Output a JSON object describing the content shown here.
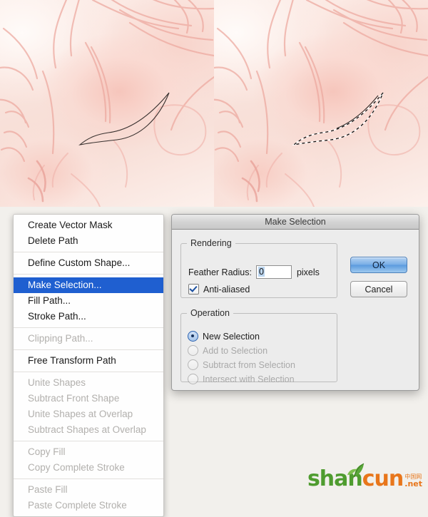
{
  "artwork": {
    "description": "anime-style face painting, left panel shows a vector path around the eye, right panel shows the resulting marching-ants selection",
    "panels": [
      {
        "name": "path-panel",
        "annotation": "bezier path outline"
      },
      {
        "name": "selection-panel",
        "annotation": "marching ants selection"
      }
    ],
    "colors": {
      "skin_light": "#fdf3ef",
      "skin_mid": "#f7dcd4",
      "line": "#e9a39b",
      "path_stroke": "#3a3230"
    }
  },
  "context_menu": {
    "name": "path-context-menu",
    "groups": [
      {
        "items": [
          {
            "label": "Create Vector Mask",
            "state": "enabled"
          },
          {
            "label": "Delete Path",
            "state": "enabled"
          }
        ]
      },
      {
        "items": [
          {
            "label": "Define Custom Shape...",
            "state": "enabled"
          }
        ]
      },
      {
        "items": [
          {
            "label": "Make Selection...",
            "state": "selected"
          },
          {
            "label": "Fill Path...",
            "state": "enabled"
          },
          {
            "label": "Stroke Path...",
            "state": "enabled"
          }
        ]
      },
      {
        "items": [
          {
            "label": "Clipping Path...",
            "state": "disabled"
          }
        ]
      },
      {
        "items": [
          {
            "label": "Free Transform Path",
            "state": "enabled"
          }
        ]
      },
      {
        "items": [
          {
            "label": "Unite Shapes",
            "state": "disabled"
          },
          {
            "label": "Subtract Front Shape",
            "state": "disabled"
          },
          {
            "label": "Unite Shapes at Overlap",
            "state": "disabled"
          },
          {
            "label": "Subtract Shapes at Overlap",
            "state": "disabled"
          }
        ]
      },
      {
        "items": [
          {
            "label": "Copy Fill",
            "state": "disabled"
          },
          {
            "label": "Copy Complete Stroke",
            "state": "disabled"
          }
        ]
      },
      {
        "items": [
          {
            "label": "Paste Fill",
            "state": "disabled"
          },
          {
            "label": "Paste Complete Stroke",
            "state": "disabled"
          }
        ]
      }
    ],
    "highlight_color": "#1f5fd0"
  },
  "dialog": {
    "title": "Make Selection",
    "rendering": {
      "legend": "Rendering",
      "feather_label": "Feather Radius:",
      "feather_value": "0",
      "feather_units": "pixels",
      "antialias_label": "Anti-aliased",
      "antialias_checked": true
    },
    "operation": {
      "legend": "Operation",
      "options": [
        {
          "label": "New Selection",
          "selected": true,
          "enabled": true
        },
        {
          "label": "Add to Selection",
          "selected": false,
          "enabled": false
        },
        {
          "label": "Subtract from Selection",
          "selected": false,
          "enabled": false
        },
        {
          "label": "Intersect with Selection",
          "selected": false,
          "enabled": false
        }
      ]
    },
    "buttons": {
      "ok": "OK",
      "cancel": "Cancel",
      "default": "ok"
    }
  },
  "watermark": {
    "shan": "shan",
    "cun": "cun",
    "cn_text": "中国网",
    "net": ".net",
    "green": "#4f9c2f",
    "orange": "#e8761b"
  }
}
